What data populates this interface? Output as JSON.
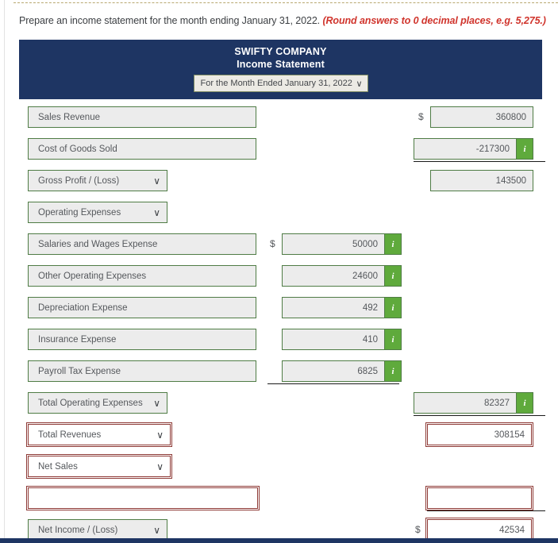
{
  "instructions": {
    "text": "Prepare an income statement for the month ending January 31, 2022.",
    "hint": "(Round answers to 0 decimal places, e.g. 5,275.)"
  },
  "statement_header": {
    "company": "SWIFTY COMPANY",
    "title": "Income Statement",
    "period_selected": "For the Month Ended January 31, 2022",
    "background_color": "#1e3563"
  },
  "symbols": {
    "dollar": "$",
    "info": "i"
  },
  "colors": {
    "ok_border": "#4f7c45",
    "error_border": "#8e3a36",
    "info_badge": "#5faa3c",
    "field_fill": "#ececec",
    "navy": "#1e3563",
    "hint_red": "#d0342c"
  },
  "rows": [
    {
      "label": "Sales Revenue",
      "value": "360800",
      "dollar": true
    },
    {
      "label": "Cost of Goods Sold",
      "value": "-217300",
      "dollar": false
    },
    {
      "label": "Gross Profit / (Loss)",
      "value": "143500",
      "dollar": false
    },
    {
      "label": "Operating Expenses",
      "value": "",
      "dollar": false
    },
    {
      "label": "Salaries and Wages Expense",
      "value": "50000",
      "dollar": true
    },
    {
      "label": "Other Operating Expenses",
      "value": "24600",
      "dollar": false
    },
    {
      "label": "Depreciation Expense",
      "value": "492",
      "dollar": false
    },
    {
      "label": "Insurance Expense",
      "value": "410",
      "dollar": false
    },
    {
      "label": "Payroll Tax Expense",
      "value": "6825",
      "dollar": false
    },
    {
      "label": "Total Operating Expenses",
      "value": "82327",
      "dollar": false
    },
    {
      "label": "Total Revenues",
      "value": "308154",
      "dollar": false
    },
    {
      "label": "Net Sales",
      "value": "",
      "dollar": false
    },
    {
      "label": "",
      "value": "",
      "dollar": false
    },
    {
      "label": "Net Income / (Loss)",
      "value": "42534",
      "dollar": true
    }
  ]
}
